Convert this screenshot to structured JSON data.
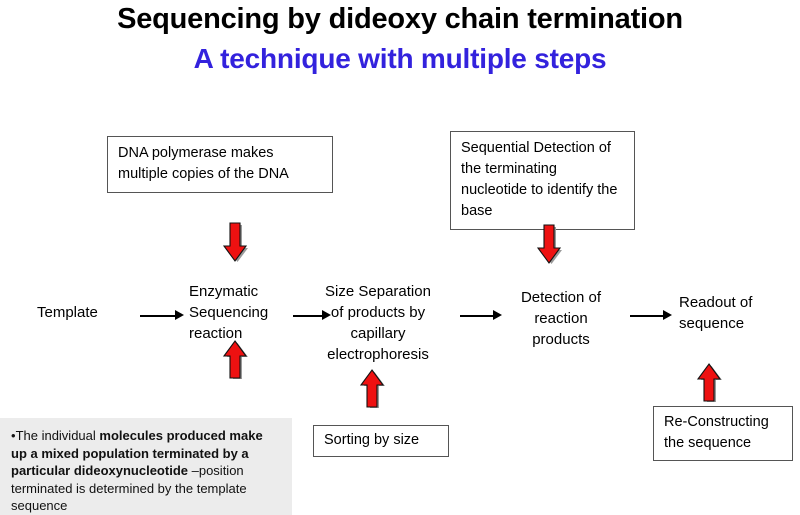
{
  "title": {
    "main": "Sequencing by dideoxy chain termination",
    "sub": "A technique with multiple steps",
    "main_color": "#000000",
    "sub_color": "#3322dd"
  },
  "callouts": [
    {
      "id": "polymerase",
      "text": "DNA polymerase makes\nmultiple copies of  the DNA"
    },
    {
      "id": "detection",
      "text": "Sequential Detection\nof the terminating\nnucleotide to identify\nthe base"
    },
    {
      "id": "sorting",
      "text": "Sorting by size"
    },
    {
      "id": "reconstruct",
      "text": "Re-Constructing\nthe sequence"
    }
  ],
  "flow": {
    "steps": [
      {
        "id": "template",
        "label": "Template"
      },
      {
        "id": "enzymatic",
        "label": "Enzymatic\nSequencing\nreaction"
      },
      {
        "id": "size",
        "label": "Size Separation\nof products by\ncapillary\nelectrophoresis"
      },
      {
        "id": "detection",
        "label": "Detection of\nreaction\nproducts"
      },
      {
        "id": "readout",
        "label": "Readout of\nsequence"
      }
    ],
    "connector_icon": "right-arrow-icon",
    "connector_color": "#000000"
  },
  "block_arrows": [
    {
      "id": "red-down-1",
      "direction": "down",
      "icon": "down-block-arrow-icon",
      "color": "#ee1111"
    },
    {
      "id": "red-up-1",
      "direction": "up",
      "icon": "up-block-arrow-icon",
      "color": "#ee1111"
    },
    {
      "id": "red-up-2",
      "direction": "up",
      "icon": "up-block-arrow-icon",
      "color": "#ee1111"
    },
    {
      "id": "red-down-2",
      "direction": "down",
      "icon": "down-block-arrow-icon",
      "color": "#ee1111"
    },
    {
      "id": "red-up-3",
      "direction": "up",
      "icon": "up-block-arrow-icon",
      "color": "#ee1111"
    }
  ],
  "note": {
    "background": "#ececec",
    "bullet": "•",
    "segments": [
      {
        "text": "The individual ",
        "bold": false
      },
      {
        "text": "molecules  produced make  up a mixed population terminated by a particular dideoxynucleotide ",
        "bold": true
      },
      {
        "text": "–position terminated is determined by the template sequence",
        "bold": false
      }
    ]
  }
}
